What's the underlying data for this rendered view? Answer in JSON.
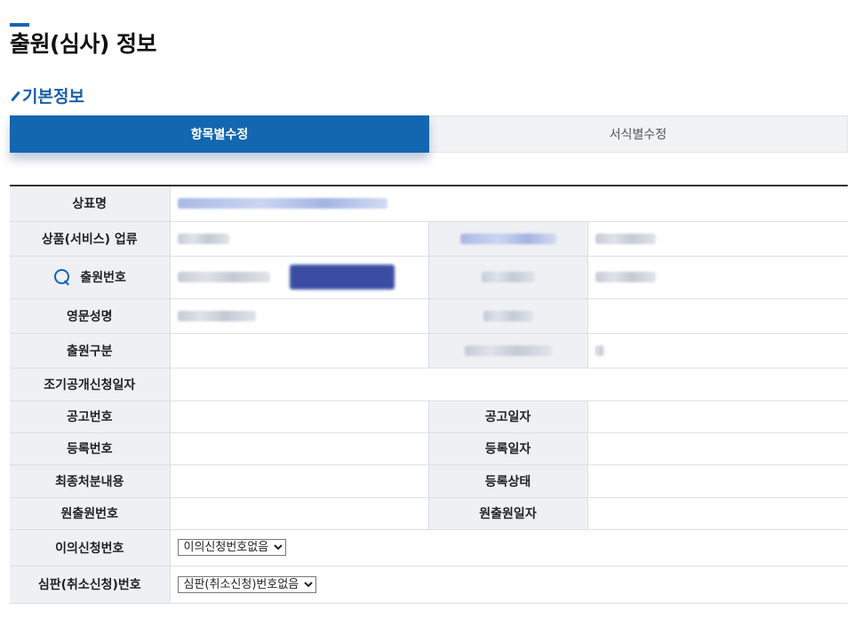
{
  "page": {
    "title": "출원(심사) 정보"
  },
  "section": {
    "title": "기본정보"
  },
  "tabs": [
    {
      "label": "항목별수정",
      "active": true
    },
    {
      "label": "서식별수정",
      "active": false
    }
  ],
  "rows": {
    "trademark_name": "상표명",
    "goods_class": "상품(서비스) 업류",
    "app_number": "출원번호",
    "english_name": "영문성명",
    "app_type": "출원구분",
    "early_pub_date": "조기공개신청일자",
    "pub_number": "공고번호",
    "pub_date": "공고일자",
    "reg_number": "등록번호",
    "reg_date": "등록일자",
    "final_disposition": "최종처분내용",
    "reg_status": "등록상태",
    "orig_app_number": "원출원번호",
    "orig_app_date": "원출원일자",
    "objection_number": "이의신청번호",
    "trial_number": "심판(취소신청)번호"
  },
  "selects": {
    "objection": {
      "selected": "이의신청번호없음"
    },
    "trial": {
      "selected": "심판(취소신청)번호없음"
    }
  },
  "icons": {
    "search": "search-icon",
    "section": "pen-icon"
  },
  "colors": {
    "accent": "#1366b0",
    "section_title": "#1a5fa8",
    "header_bg": "#eef0f3"
  }
}
